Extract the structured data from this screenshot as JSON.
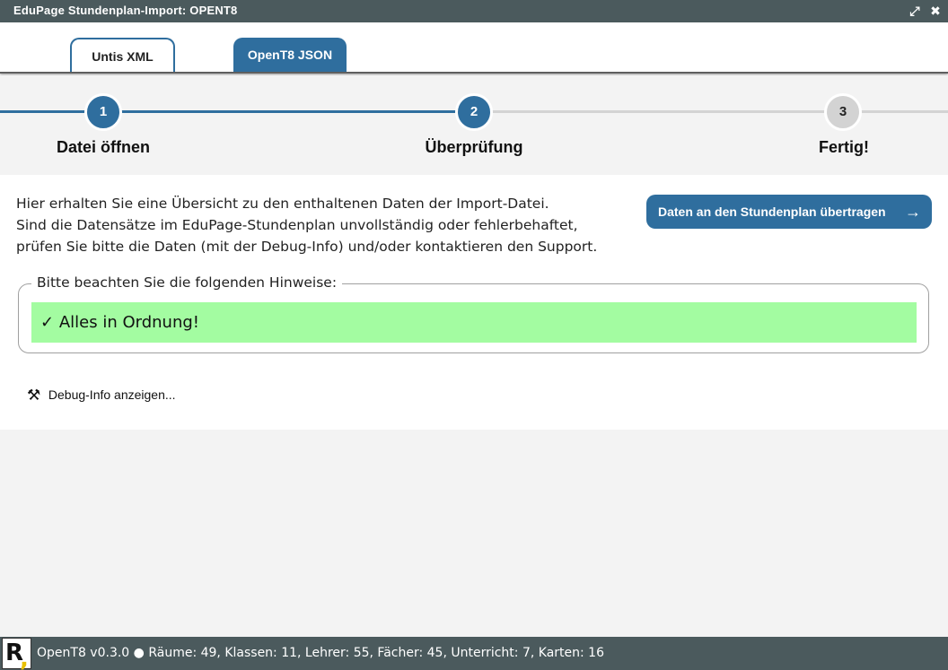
{
  "window": {
    "title": "EduPage Stundenplan-Import: OPENT8",
    "expand_glyph": "⤢",
    "close_glyph": "✖"
  },
  "tabs": [
    {
      "label": "Untis XML",
      "active": false
    },
    {
      "label": "OpenT8 JSON",
      "active": true
    }
  ],
  "steps": [
    {
      "number": "1",
      "label": "Datei öffnen",
      "state": "done"
    },
    {
      "number": "2",
      "label": "Überprüfung",
      "state": "current"
    },
    {
      "number": "3",
      "label": "Fertig!",
      "state": "pending"
    }
  ],
  "intro": {
    "line1": "Hier erhalten Sie eine Übersicht zu den enthaltenen Daten der Import-Datei.",
    "line2": "Sind die Datensätze im EduPage-Stundenplan unvollständig oder fehlerbehaftet,",
    "line3": "prüfen Sie bitte die Daten (mit der Debug-Info) und/oder kontaktieren den Support."
  },
  "transfer_button": {
    "label": "Daten an den Stundenplan übertragen",
    "arrow": "→"
  },
  "notices": {
    "legend": "Bitte beachten Sie die folgenden Hinweise:",
    "check_glyph": "✓",
    "message": "Alles in Ordnung!"
  },
  "debug_link": {
    "icon": "hammer-pick-icon",
    "glyph": "⚒",
    "label": "Debug-Info anzeigen..."
  },
  "footer": {
    "logo_letter": "R",
    "logo_comma": ",",
    "status": "OpenT8 v0.3.0 ● Räume: 49, Klassen: 11, Lehrer: 55, Fächer: 45, Unterricht: 7, Karten: 16"
  },
  "colors": {
    "accent": "#2f6e9e",
    "titlebar": "#4b5a5d",
    "success": "#a3fca1",
    "pending_step": "#d3d3d3"
  }
}
